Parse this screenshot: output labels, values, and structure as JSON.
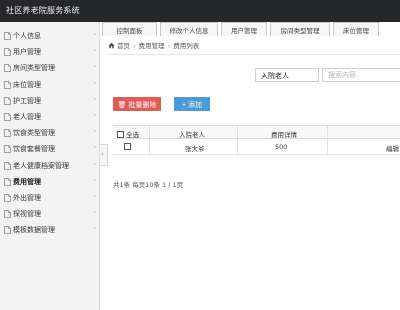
{
  "app": {
    "title": "社区养老院服务系统"
  },
  "top_tabs": [
    {
      "label": "控制面板"
    },
    {
      "label": "修改个人信息"
    },
    {
      "label": "用户管理"
    },
    {
      "label": "房间类型管理"
    },
    {
      "label": "床位管理"
    }
  ],
  "sidebar": {
    "items": [
      {
        "label": "个人信息",
        "active": false
      },
      {
        "label": "用户管理",
        "active": false
      },
      {
        "label": "房间类型管理",
        "active": false
      },
      {
        "label": "床位管理",
        "active": false
      },
      {
        "label": "护工管理",
        "active": false
      },
      {
        "label": "老人管理",
        "active": false
      },
      {
        "label": "饮食类型管理",
        "active": false
      },
      {
        "label": "饮食套餐管理",
        "active": false
      },
      {
        "label": "老人健康档案管理",
        "active": false
      },
      {
        "label": "费用管理",
        "active": true
      },
      {
        "label": "外出管理",
        "active": false
      },
      {
        "label": "探视管理",
        "active": false
      },
      {
        "label": "模板数据管理",
        "active": false
      }
    ]
  },
  "breadcrumb": {
    "home": "首页",
    "level1": "费用管理",
    "level2": "费用列表"
  },
  "filter": {
    "select_value": "入院老人",
    "search_placeholder": "搜索内容"
  },
  "actions": {
    "batch_delete": "批量删除",
    "add": "添加"
  },
  "table": {
    "headers": {
      "select_all": "全选",
      "elder": "入院老人",
      "cost": "费用详情"
    },
    "rows": [
      {
        "elder": "张大爷",
        "cost": "500",
        "op": "编辑"
      }
    ]
  },
  "pager": {
    "text": "共1条  每页10条  1 / 1页"
  },
  "colors": {
    "topbar": "#26272b",
    "delete_button": "#e15a56",
    "add_button": "#4c9ad7",
    "sidebar_bg": "#f3f3f3"
  }
}
